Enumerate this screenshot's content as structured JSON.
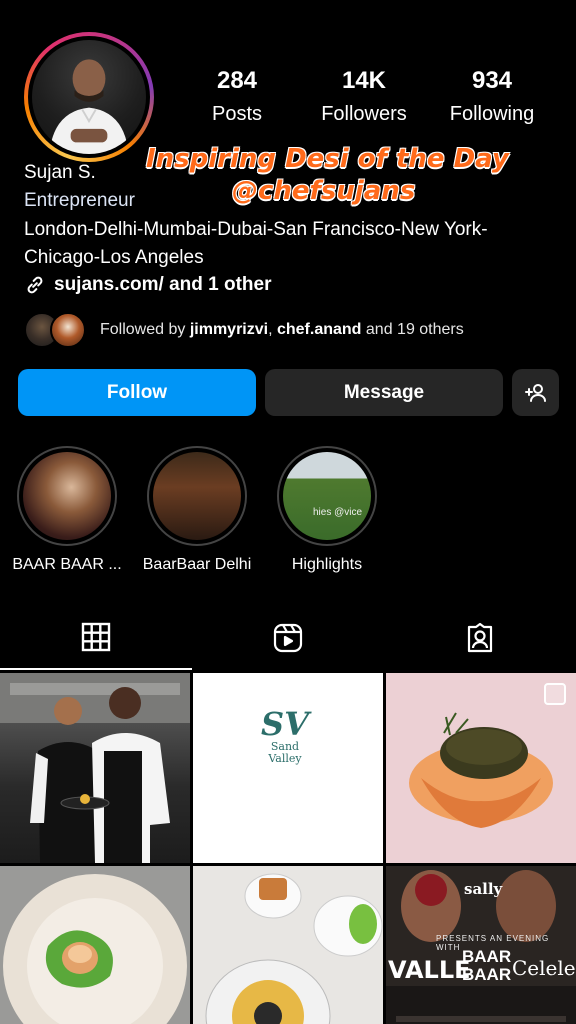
{
  "profile": {
    "name": "Sujan S.",
    "category": "Entrepreneur",
    "bio": "London-Delhi-Mumbai-Dubai-San Francisco-New York-Chicago-Los Angeles",
    "link_text": "sujans.com/ and 1 other"
  },
  "stats": {
    "posts": {
      "value": "284",
      "label": "Posts"
    },
    "followers": {
      "value": "14K",
      "label": "Followers"
    },
    "following": {
      "value": "934",
      "label": "Following"
    }
  },
  "overlay": {
    "line1": "Inspiring Desi of the Day",
    "line2": "@chefsujans",
    "color": "#ff6a1a"
  },
  "followed_by": {
    "prefix": "Followed by ",
    "user1": "jimmyrizvi",
    "separator": ", ",
    "user2": "chef.anand",
    "suffix": " and 19 others"
  },
  "actions": {
    "follow_label": "Follow",
    "message_label": "Message",
    "follow_color": "#0095f6"
  },
  "highlights": [
    {
      "label": "BAAR BAAR ..."
    },
    {
      "label": "BaarBaar Delhi"
    },
    {
      "label": "Highlights",
      "overlay_text": "hies @vice"
    }
  ],
  "tabs": [
    {
      "icon": "grid-icon",
      "selected": true
    },
    {
      "icon": "reels-icon",
      "selected": false
    },
    {
      "icon": "tagged-icon",
      "selected": false
    }
  ],
  "posts": {
    "post2": {
      "logo_line1": "Sand",
      "logo_line2": "Valley"
    },
    "post6": {
      "title": "sally",
      "sub": "PRESENTS AN EVENING WITH",
      "word1": "VALLE",
      "word2": "BAAR BAAR",
      "word3": "Celele."
    }
  }
}
